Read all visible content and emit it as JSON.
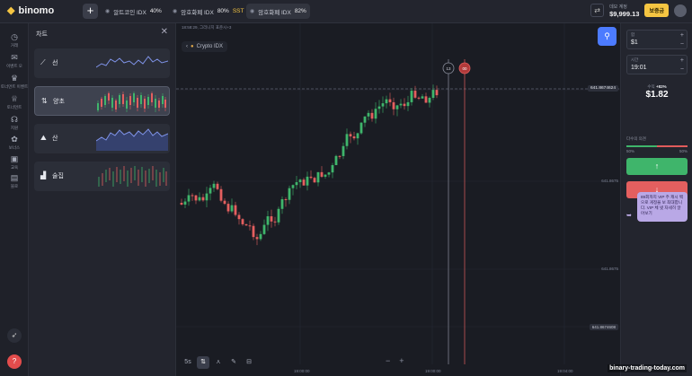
{
  "brand": {
    "name": "binomo"
  },
  "tabs": [
    {
      "label": "알트코인 IDX",
      "pct": "40%",
      "active": false
    },
    {
      "label": "암호화폐 IDX",
      "pct": "80%",
      "badge": "SST",
      "active": false
    },
    {
      "label": "암호화폐 IDX",
      "pct": "82%",
      "active": true
    }
  ],
  "account": {
    "type": "데모 계정",
    "balance": "$9,999.13",
    "bonus_label": "보증금"
  },
  "nav": [
    {
      "label": "거래",
      "icon": "clock-icon"
    },
    {
      "label": "이벤트 오",
      "icon": "chat-icon"
    },
    {
      "label": "토너먼트 이벤트",
      "icon": "trophy-icon"
    },
    {
      "label": "토너먼트",
      "icon": "trophy-icon"
    },
    {
      "label": "지원",
      "icon": "headset-icon"
    },
    {
      "label": "보너스",
      "icon": "gift-icon"
    },
    {
      "label": "교육",
      "icon": "graduation-icon"
    },
    {
      "label": "블로",
      "icon": "book-icon"
    }
  ],
  "panel": {
    "title": "차트",
    "chart_types": [
      {
        "label": "선",
        "icon": "line-chart-icon"
      },
      {
        "label": "양초",
        "icon": "candles-icon"
      },
      {
        "label": "산",
        "icon": "area-chart-icon"
      },
      {
        "label": "술집",
        "icon": "bars-icon"
      }
    ]
  },
  "chart": {
    "header": "18:58:29, 그리니치 표준시+3",
    "asset": "Crypto IDX",
    "prices": {
      "current": "641.8674624",
      "level2": "641.8675",
      "level3": "641.8675",
      "level4": "641.8674608"
    },
    "times": [
      "19:00:00",
      "19:04:00",
      "19:00:00"
    ],
    "timer_a": "13",
    "timer_b": "00",
    "timeframe": "5s",
    "plus": "+",
    "minus": "−"
  },
  "trade": {
    "amount_label": "합",
    "amount": "$1",
    "time_label": "시간",
    "time": "19:01",
    "payout_label": "수익",
    "payout_pct": "+82%",
    "payout_amount": "$1.82",
    "sentiment_label": "다수의 의견",
    "sentiment_left": "50%",
    "sentiment_right": "50%"
  },
  "chat": {
    "text": "89회까지 VIP 주 캐시 백 으로 게정을 보 최대합니다. VIP 체 넷 자세히 알아보기"
  },
  "watermark": "binary-trading-today.com"
}
